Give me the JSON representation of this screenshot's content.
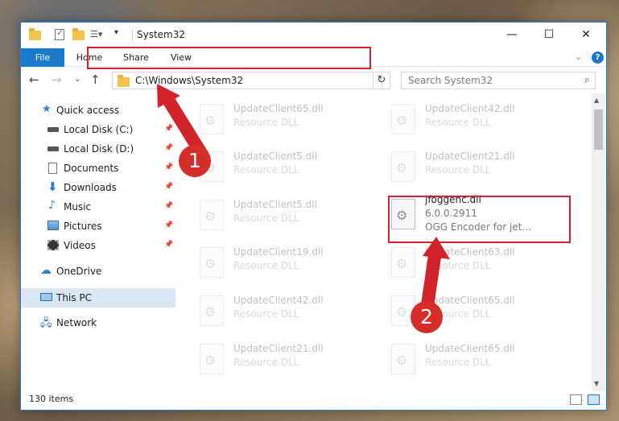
{
  "window": {
    "title": "System32",
    "controls": {
      "minimize": "—",
      "maximize": "☐",
      "close": "✕"
    }
  },
  "ribbon": {
    "tabs": [
      {
        "label": "File"
      },
      {
        "label": "Home"
      },
      {
        "label": "Share"
      },
      {
        "label": "View"
      }
    ],
    "expand_glyph": "⌄",
    "help_glyph": "?"
  },
  "navigation": {
    "back": "←",
    "forward": "→",
    "recent": "⌄",
    "up": "↑",
    "address": "C:\\Windows\\System32",
    "address_dropdown": "⌄",
    "refresh": "↻",
    "search_placeholder": "Search System32",
    "search_icon": "⌕"
  },
  "sidebar": {
    "items": [
      {
        "label": "Quick access",
        "icon": "star-icon"
      },
      {
        "label": "Local Disk (C:)",
        "icon": "drive-icon",
        "pinned": true
      },
      {
        "label": "Local Disk (D:)",
        "icon": "drive-icon",
        "pinned": true
      },
      {
        "label": "Documents",
        "icon": "documents-icon",
        "pinned": true
      },
      {
        "label": "Downloads",
        "icon": "download-icon",
        "pinned": true
      },
      {
        "label": "Music",
        "icon": "music-icon",
        "pinned": true
      },
      {
        "label": "Pictures",
        "icon": "pictures-icon",
        "pinned": true
      },
      {
        "label": "Videos",
        "icon": "videos-icon",
        "pinned": true
      },
      {
        "label": "OneDrive",
        "icon": "cloud-icon"
      },
      {
        "label": "This PC",
        "icon": "computer-icon",
        "selected": true
      },
      {
        "label": "Network",
        "icon": "network-icon"
      }
    ],
    "pin_glyph": "📌"
  },
  "files": {
    "left": [
      {
        "name": "UpdateClient65.dll",
        "type": "Resource DLL"
      },
      {
        "name": "UpdateClient5.dll",
        "type": "Resource DLL"
      },
      {
        "name": "UpdateClient5.dll",
        "type": "Resource DLL"
      },
      {
        "name": "UpdateClient19.dll",
        "type": "Resource DLL"
      },
      {
        "name": "UpdateClient42.dll",
        "type": "Resource DLL"
      },
      {
        "name": "UpdateClient21.dll",
        "type": "Resource DLL"
      }
    ],
    "right": [
      {
        "name": "UpdateClient42.dll",
        "type": "Resource DLL"
      },
      {
        "name": "UpdateClient21.dll",
        "type": "Resource DLL"
      },
      {
        "name": "jfoggenc.dll",
        "version": "6.0.0.2911",
        "description": "OGG Encoder for jet...",
        "highlighted": true
      },
      {
        "name": "UpdateClient63.dll",
        "type": "Resource DLL"
      },
      {
        "name": "UpdateClient65.dll",
        "type": "Resource DLL"
      },
      {
        "name": "UpdateClient65.dll",
        "type": "Resource DLL"
      }
    ]
  },
  "status": {
    "items_count": "130 items"
  },
  "annotations": {
    "step1": "1",
    "step2": "2",
    "color": "#d2232a"
  }
}
